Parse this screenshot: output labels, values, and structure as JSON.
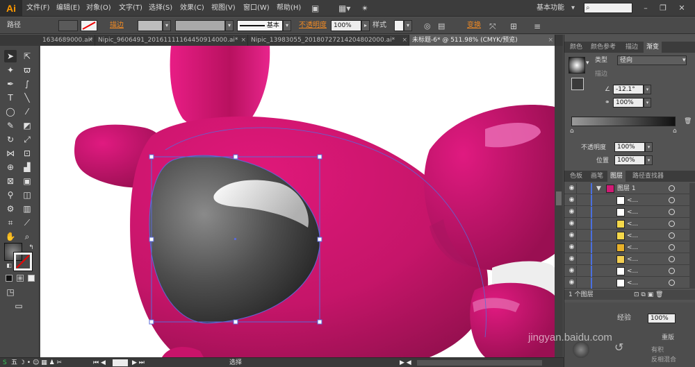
{
  "app": {
    "logo": "Ai",
    "menu": [
      "文件(F)",
      "编辑(E)",
      "对象(O)",
      "文字(T)",
      "选择(S)",
      "效果(C)",
      "视图(V)",
      "窗口(W)",
      "帮助(H)"
    ],
    "workspace": "基本功能",
    "workspace_arrow": "▾"
  },
  "control_bar": {
    "object_type": "路径",
    "stroke_label": "描边",
    "stroke_profile": "基本",
    "opacity_label": "不透明度",
    "opacity_value": "100%",
    "style_label": "样式",
    "transform_label": "变换"
  },
  "tabs": [
    {
      "label": "1634689000.ai*",
      "active": false
    },
    {
      "label": "Nipic_9606491_20161111164450914000.ai*",
      "active": false
    },
    {
      "label": "Nipic_13983055_20180727214204802000.ai*",
      "active": false
    },
    {
      "label": "未标题-6* @ 511.98% (CMYK/预览)",
      "active": true
    }
  ],
  "tab_close": "×",
  "panels": {
    "top_tabs": [
      "颜色",
      "颜色参考",
      "描边",
      "渐变"
    ],
    "gradient": {
      "type_label": "类型",
      "type_value": "径向",
      "stroke_label": "描边",
      "angle_value": "-12.1°",
      "aspect_value": "100%",
      "opacity_label": "不透明度",
      "opacity_value": "100%",
      "location_label": "位置",
      "location_value": "100%"
    },
    "layer_tabs": [
      "色板",
      "画笔",
      "图层",
      "路径查找器"
    ],
    "layers": {
      "main_layer": "图层 1",
      "sublayers": [
        "<...",
        "<...",
        "<...",
        "<...",
        "<...",
        "<...",
        "<...",
        "<..."
      ],
      "footer_count": "1 个图层"
    }
  },
  "status_bar": {
    "mode": "选择"
  },
  "overlay": {
    "watermark": "jingyan.baidu.com",
    "text1": "经验",
    "text2": "100%",
    "text3": "重版",
    "text4": "有积",
    "text5": "反相混合"
  },
  "colors": {
    "accent": "#f08a24",
    "pink_body": "#d01a74",
    "selection": "#5a6ad8"
  }
}
